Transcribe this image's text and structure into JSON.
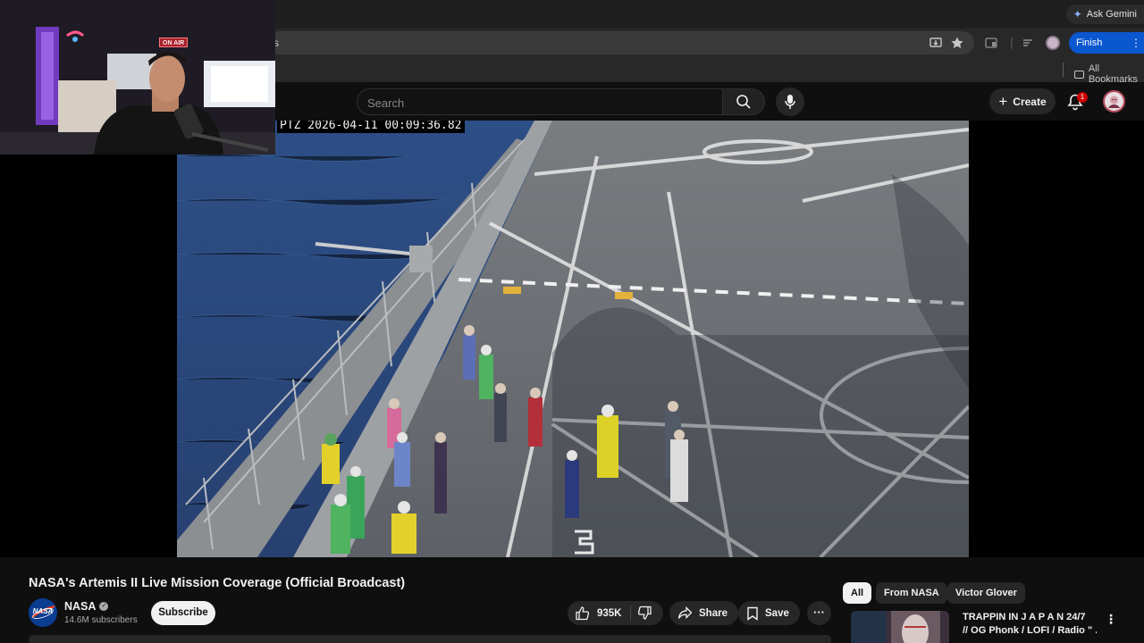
{
  "browser": {
    "ask_gemini": "Ask Gemini",
    "url_fragment": "s",
    "finish_update": "Finish update",
    "all_bookmarks": "All Bookmarks"
  },
  "masthead": {
    "search_placeholder": "Search",
    "create_label": "Create",
    "notification_count": "1"
  },
  "webcam": {
    "on_air": "ON AIR"
  },
  "video": {
    "timestamp": "PTZ 2026-04-11 00:09:36.82",
    "title": "NASA's Artemis II Live Mission Coverage (Official Broadcast)"
  },
  "channel": {
    "name": "NASA",
    "avatar_text": "NASA",
    "subscribers": "14.6M subscribers",
    "subscribe_label": "Subscribe"
  },
  "actions": {
    "likes": "935K",
    "share": "Share",
    "save": "Save"
  },
  "chips": [
    "All",
    "From NASA",
    "Victor Glover"
  ],
  "recommendation": {
    "title_line1": "TRAPPIN IN  J A P A N  24/7",
    "title_line2": "// OG Phonk / LOFI / Radio \" ..."
  }
}
